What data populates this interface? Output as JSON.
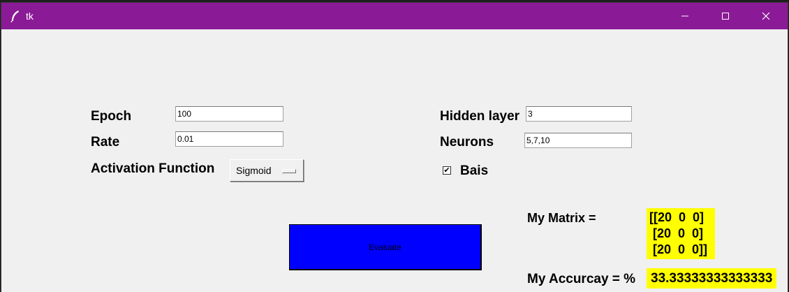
{
  "window": {
    "title": "tk",
    "accent_color": "#8a1a96"
  },
  "form": {
    "epoch_label": "Epoch",
    "epoch_value": "100",
    "rate_label": "Rate",
    "rate_value": "0.01",
    "activation_label": "Activation Function",
    "activation_selected": "Sigmoid",
    "hidden_layer_label": "Hidden layer",
    "hidden_layer_value": "3",
    "neurons_label": "Neurons",
    "neurons_value": "5,7,10",
    "bias_label": "Bais",
    "bias_checked": true,
    "evaluate_label": "Evaluate",
    "evaluate_color": "#0000ff"
  },
  "results": {
    "matrix_label": "My Matrix =",
    "matrix_rows": [
      "[[20  0  0]",
      " [20  0  0]",
      " [20  0  0]]"
    ],
    "accuracy_label": "My Accurcay = %",
    "accuracy_value": "33.33333333333333",
    "highlight_color": "#ffff00"
  }
}
